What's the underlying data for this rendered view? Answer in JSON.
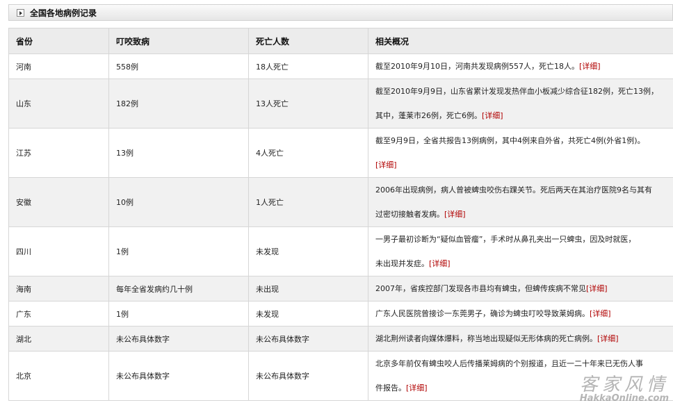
{
  "section": {
    "title": "全国各地病例记录"
  },
  "table": {
    "headers": [
      "省份",
      "叮咬致病",
      "死亡人数",
      "相关概况"
    ],
    "rows": [
      {
        "province": "河南",
        "cases": "558例",
        "deaths": "18人死亡",
        "summary": [
          "截至2010年9月10日，河南共发现病例557人，死亡18人。"
        ],
        "link": "[详细]"
      },
      {
        "province": "山东",
        "cases": "182例",
        "deaths": "13人死亡",
        "summary": [
          "截至2010年9月9日，山东省累计发现发热伴血小板减少综合征182例，死亡13例，",
          "其中，蓬莱市26例，死亡6例。"
        ],
        "link": "[详细]"
      },
      {
        "province": "江苏",
        "cases": "13例",
        "deaths": "4人死亡",
        "summary": [
          "截至9月9日，全省共报告13例病例，其中4例来自外省，共死亡4例(外省1例)。",
          ""
        ],
        "link": "[详细]"
      },
      {
        "province": "安徽",
        "cases": "10例",
        "deaths": "1人死亡",
        "summary": [
          "2006年出现病例，病人曾被蜱虫咬伤右踝关节。死后两天在其治疗医院9名与其有",
          "过密切接触者发病。"
        ],
        "link": "[详细]"
      },
      {
        "province": "四川",
        "cases": "1例",
        "deaths": "未发现",
        "summary": [
          "一男子最初诊断为“疑似血管瘤”，手术时从鼻孔夹出一只蜱虫，因及时就医，",
          "未出现并发症。"
        ],
        "link": "[详细]"
      },
      {
        "province": "海南",
        "cases": "每年全省发病约几十例",
        "deaths": "未出现",
        "summary": [
          "2007年，省疾控部门发现各市县均有蜱虫，但蜱传疾病不常见"
        ],
        "link": "[详细]"
      },
      {
        "province": "广东",
        "cases": "1例",
        "deaths": "未发现",
        "summary": [
          "广东人民医院曾接诊一东莞男子，确诊为蜱虫叮咬导致莱姆病。"
        ],
        "link": "[详细]"
      },
      {
        "province": "湖北",
        "cases": "未公布具体数字",
        "deaths": "未公布具体数字",
        "summary": [
          "湖北荆州读者向媒体爆料，称当地出现疑似无形体病的死亡病例。"
        ],
        "link": "[详细]"
      },
      {
        "province": "北京",
        "cases": "未公布具体数字",
        "deaths": "未公布具体数字",
        "summary": [
          "北京多年前仅有蜱虫咬人后传播莱姆病的个别报道，且近一二十年来已无伤人事",
          "件报告。"
        ],
        "link": "[详细]"
      }
    ]
  },
  "watermark": {
    "chinese": "客家风情",
    "english": "HakkaOnline.com"
  }
}
